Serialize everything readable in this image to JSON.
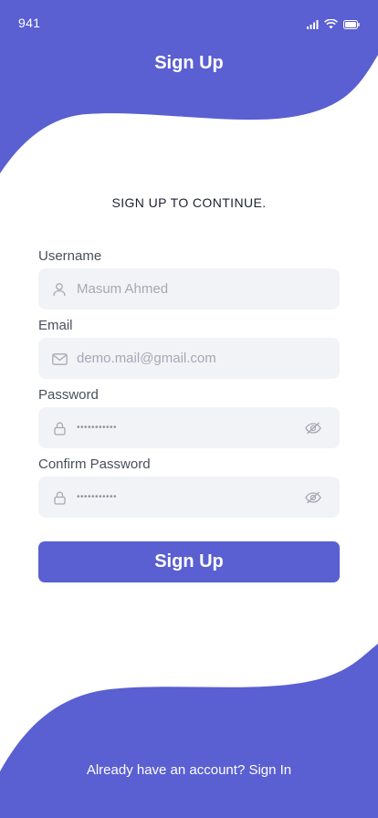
{
  "colors": {
    "accent": "#5a5fd2",
    "field_bg": "#f2f3f7",
    "placeholder": "#a5a9b4"
  },
  "status_bar": {
    "time": "941",
    "icons": [
      "signal-icon",
      "wifi-icon",
      "battery-icon"
    ]
  },
  "header": {
    "title": "Sign Up"
  },
  "form": {
    "subtitle": "SIGN UP TO CONTINUE.",
    "username": {
      "label": "Username",
      "placeholder": "Masum Ahmed",
      "icon": "user-icon"
    },
    "email": {
      "label": "Email",
      "placeholder": "demo.mail@gmail.com",
      "icon": "mail-icon"
    },
    "password": {
      "label": "Password",
      "value": "•••••••••••",
      "icon": "lock-icon",
      "toggle_icon": "eye-off-icon"
    },
    "confirm_password": {
      "label": "Confirm Password",
      "value": "•••••••••••",
      "icon": "lock-icon",
      "toggle_icon": "eye-off-icon"
    },
    "submit_label": "Sign Up"
  },
  "footer": {
    "prompt": "Already have an account?",
    "link": "Sign In"
  }
}
